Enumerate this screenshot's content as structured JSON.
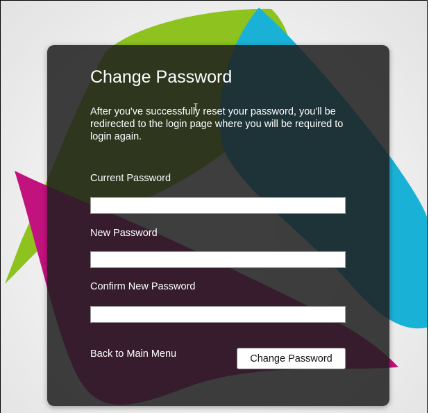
{
  "colors": {
    "green_shape": "#8dc21f",
    "magenta_shape": "#c2127e",
    "cyan_shape": "#1ab1d6",
    "card_background": "#1e1e1e",
    "text": "#ffffff"
  },
  "form": {
    "title": "Change Password",
    "description": "After you've successfully reset your password, you'll be redirected to the login page where you will be required to login again.",
    "fields": [
      {
        "label": "Current Password",
        "value": "",
        "placeholder": ""
      },
      {
        "label": "New Password",
        "value": "",
        "placeholder": ""
      },
      {
        "label": "Confirm New Password",
        "value": "",
        "placeholder": ""
      }
    ],
    "back_link": "Back to Main Menu",
    "submit_label": "Change Password"
  },
  "icons": {
    "cursor": "text-cursor-icon"
  }
}
